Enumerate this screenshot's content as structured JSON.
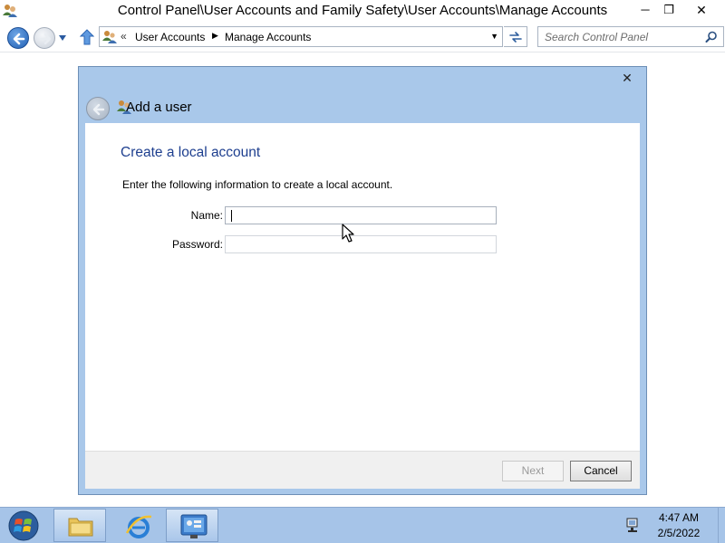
{
  "window": {
    "title": "Control Panel\\User Accounts and Family Safety\\User Accounts\\Manage Accounts",
    "controls": {
      "minimize": "─",
      "maximize": "❐",
      "close": "✕"
    }
  },
  "navbar": {
    "breadcrumb_overflow": "«",
    "breadcrumbs": [
      "User Accounts",
      "Manage Accounts"
    ],
    "breadcrumb_separator": "▶",
    "dropdown_glyph": "▼",
    "search_placeholder": "Search Control Panel"
  },
  "dialog": {
    "title": "Add a user",
    "close_glyph": "✕",
    "heading": "Create a local account",
    "instructions": "Enter the following information to create a local account.",
    "fields": {
      "name_label": "Name:",
      "name_value": "",
      "password_label": "Password:",
      "password_value": ""
    },
    "buttons": {
      "next": "Next",
      "cancel": "Cancel"
    },
    "next_enabled": false
  },
  "taskbar": {
    "apps": [
      "file-explorer",
      "internet-explorer",
      "control-panel"
    ],
    "clock_time": "4:47 AM",
    "clock_date": "2/5/2022"
  },
  "colors": {
    "dialog_frame": "#a9c8ea",
    "heading_blue": "#1e3f8f",
    "taskbar": "#a6c4e8"
  }
}
